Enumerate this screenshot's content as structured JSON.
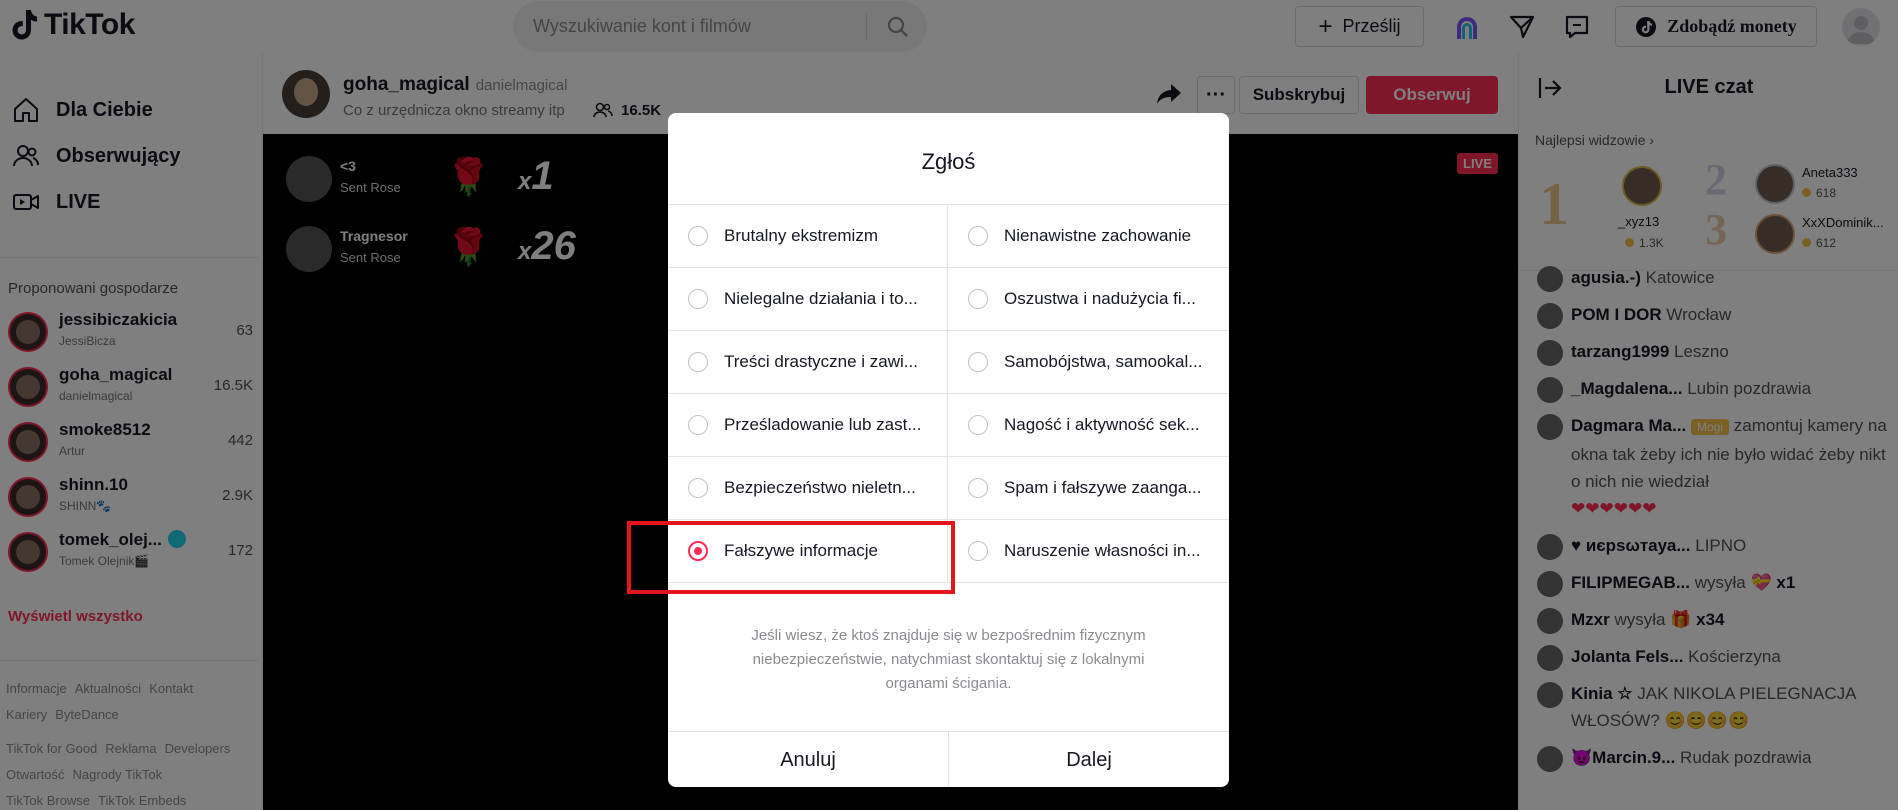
{
  "header": {
    "logo": "TikTok",
    "search_placeholder": "Wyszukiwanie kont i filmów",
    "upload_label": "Prześlij",
    "coins_label": "Zdobądź monety"
  },
  "sidebar": {
    "nav": [
      {
        "label": "Dla Ciebie",
        "icon": "home-icon"
      },
      {
        "label": "Obserwujący",
        "icon": "users-icon"
      },
      {
        "label": "LIVE",
        "icon": "live-icon"
      }
    ],
    "hosts_heading": "Proponowani gospodarze",
    "hosts": [
      {
        "name": "jessibiczakicia",
        "sub": "JessiBicza",
        "count": "63"
      },
      {
        "name": "goha_magical",
        "sub": "danielmagical",
        "count": "16.5K"
      },
      {
        "name": "smoke8512",
        "sub": "Artur",
        "count": "442"
      },
      {
        "name": "shinn.10",
        "sub": "SHINN🐾",
        "count": "2.9K"
      },
      {
        "name": "tomek_olej...",
        "sub": "Tomek Olejnik🎬",
        "count": "172"
      }
    ],
    "see_all": "Wyświetl wszystko",
    "footer": [
      [
        "Informacje",
        "Aktualności",
        "Kontakt"
      ],
      [
        "Kariery",
        "ByteDance"
      ],
      [
        "TikTok for Good",
        "Reklama",
        "Developers"
      ],
      [
        "Otwartość",
        "Nagrody TikTok"
      ],
      [
        "TikTok Browse",
        "TikTok Embeds"
      ]
    ]
  },
  "stream": {
    "creator_name": "goha_magical",
    "creator_handle": "danielmagical",
    "description": "Co z urzędnicza okno streamy itp",
    "viewers": "16.5K",
    "subscribe_label": "Subskrybuj",
    "follow_label": "Obserwuj",
    "live_badge": "LIVE",
    "gifts": [
      {
        "user": "<3",
        "action": "Sent Rose",
        "count": "1"
      },
      {
        "user": "Tragnesor",
        "action": "Sent Rose",
        "count": "26"
      }
    ]
  },
  "chat": {
    "title": "LIVE czat",
    "top_viewers_label": "Najlepsi widzowie",
    "top": [
      {
        "rank": "1",
        "name": "_xyz13",
        "coins": "1.3K"
      },
      {
        "rank": "2",
        "name": "Aneta333",
        "coins": "618"
      },
      {
        "rank": "3",
        "name": "XxXDominik...",
        "coins": "612"
      }
    ],
    "messages": [
      {
        "user": "agusia.-)",
        "text": "Katowice"
      },
      {
        "user": "POM I DOR",
        "text": "Wrocław"
      },
      {
        "user": "tarzang1999",
        "text": "Leszno"
      },
      {
        "user": "_Magdalena...",
        "text": "Lubin pozdrawia"
      },
      {
        "user": "Dagmara Ma...",
        "badge": "Mogi",
        "text": "zamontuj kamery na okna tak żeby ich nie było widać żeby nikt o nich nie wiedział",
        "hearts": "❤❤❤❤❤❤"
      },
      {
        "user": "♥ иєрѕωтауа...",
        "text": "LIPNO"
      },
      {
        "user": "FILIPMEGAB...",
        "text": "wysyła",
        "gift_count": "x1"
      },
      {
        "user": "Mzxr",
        "text": "wysyła",
        "gift_count": "x34"
      },
      {
        "user": "Jolanta Fels...",
        "text": "Kościerzyna"
      },
      {
        "user": "Kinia ☆",
        "text": "JAK NIKOLA PIELEGNACJA WŁOSÓW? 😊😊😊😊"
      },
      {
        "user": "😈Marcin.9...",
        "text": "Rudak pozdrawia"
      }
    ]
  },
  "modal": {
    "title": "Zgłoś",
    "options_left": [
      "Brutalny ekstremizm",
      "Nielegalne działania i to...",
      "Treści drastyczne i zawi...",
      "Prześladowanie lub zast...",
      "Bezpieczeństwo nieletn...",
      "Fałszywe informacje"
    ],
    "options_right": [
      "Nienawistne zachowanie",
      "Oszustwa i nadużycia fi...",
      "Samobójstwa, samookal...",
      "Nagość i aktywność sek...",
      "Spam i fałszywe zaanga...",
      "Naruszenie własności in..."
    ],
    "selected": "Fałszywe informacje",
    "safety_note": "Jeśli wiesz, że ktoś znajduje się w bezpośrednim fizycznym niebezpieczeństwie, natychmiast skontaktuj się z lokalnymi organami ścigania.",
    "cancel_label": "Anuluj",
    "next_label": "Dalej"
  },
  "colors": {
    "brand": "#fe2c55",
    "highlight": "#e3161b"
  }
}
